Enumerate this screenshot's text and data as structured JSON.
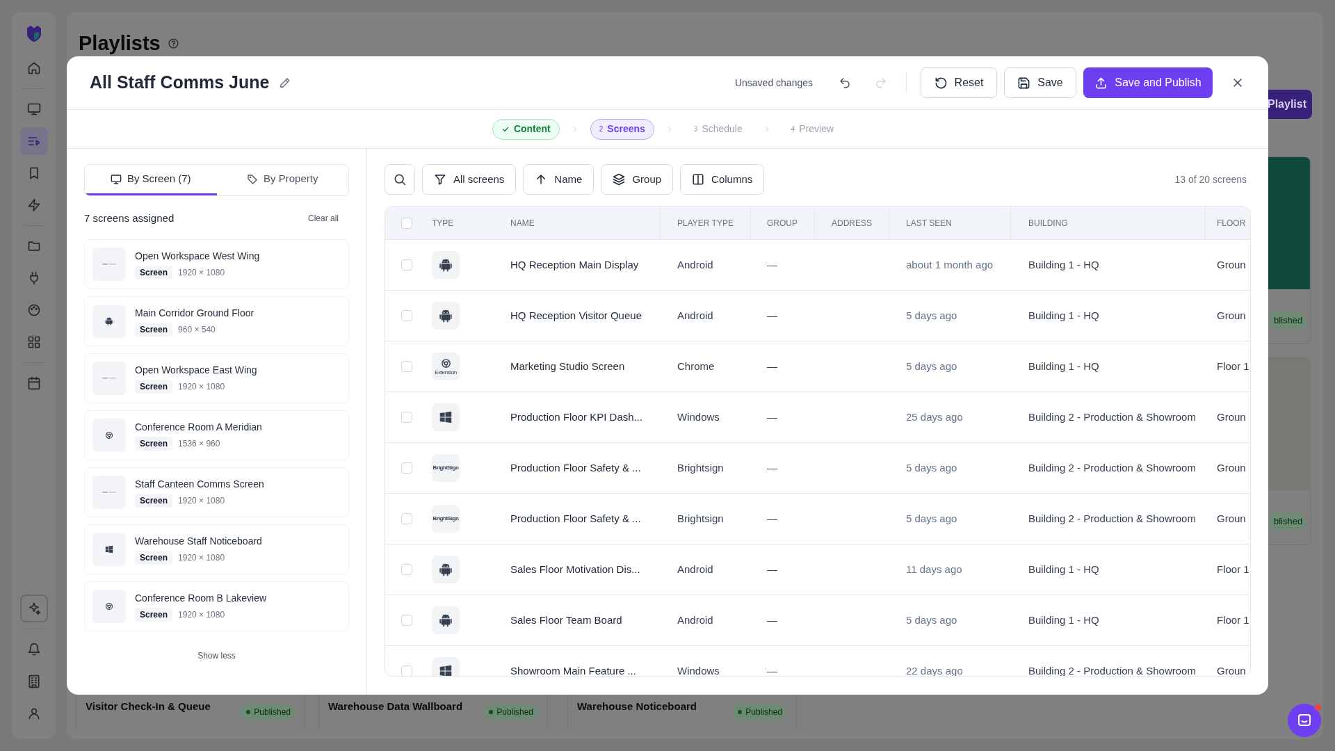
{
  "nav": {
    "sections_top": [
      [
        {
          "selected": false
        }
      ],
      [
        {
          "selected": false
        },
        {
          "selected": true
        },
        {
          "selected": false
        },
        {
          "selected": false
        }
      ],
      [
        {
          "selected": false
        },
        {
          "selected": false
        },
        {
          "selected": false
        },
        {
          "selected": false
        }
      ],
      [
        {
          "selected": false
        }
      ]
    ],
    "sections_bottom": [
      [
        {
          "selected": false
        }
      ],
      [
        {
          "selected": false
        },
        {
          "selected": false
        },
        {
          "selected": false
        }
      ]
    ]
  },
  "page": {
    "title": "Playlists",
    "new_button": "Playlist",
    "side_cards": [
      {
        "status": "blished"
      },
      {
        "status": "blished"
      }
    ],
    "bottom_cards": [
      {
        "title": "Visitor Check-In & Queue",
        "status": "Published"
      },
      {
        "title": "Warehouse Data Wallboard",
        "status": "Published"
      },
      {
        "title": "Warehouse Noticeboard",
        "status": "Published"
      }
    ]
  },
  "modal": {
    "title": "All Staff Comms June",
    "unsaved": "Unsaved changes",
    "undo": {
      "disabled": false
    },
    "redo": {
      "disabled": true
    },
    "buttons": [
      {
        "kind": "reset",
        "label": "Reset"
      },
      {
        "kind": "save",
        "label": "Save"
      },
      {
        "kind": "publish",
        "label": "Save and Publish"
      }
    ],
    "steps": [
      {
        "label": "Content",
        "completed": true,
        "selected": false
      },
      {
        "number": "2",
        "label": "Screens",
        "completed": false,
        "selected": true
      },
      {
        "number": "3",
        "label": "Schedule",
        "completed": false,
        "selected": false
      },
      {
        "number": "4",
        "label": "Preview",
        "completed": false,
        "selected": false
      }
    ],
    "left": {
      "tabs": [
        {
          "label": "By Screen (7)",
          "selected": true
        },
        {
          "label": "By Property",
          "selected": false
        }
      ],
      "assigned": "7 screens assigned",
      "clear": "Clear all",
      "screens": [
        {
          "name": "Open Workspace West Wing",
          "badge": "Screen",
          "resolution": "1920 × 1080",
          "kind": "brightsign"
        },
        {
          "name": "Main Corridor Ground Floor",
          "badge": "Screen",
          "resolution": "960 × 540",
          "kind": "android"
        },
        {
          "name": "Open Workspace East Wing",
          "badge": "Screen",
          "resolution": "1920 × 1080",
          "kind": "brightsign"
        },
        {
          "name": "Conference Room A Meridian",
          "badge": "Screen",
          "resolution": "1536 × 960",
          "kind": "chrome"
        },
        {
          "name": "Staff Canteen Comms Screen",
          "badge": "Screen",
          "resolution": "1920 × 1080",
          "kind": "brightsign"
        },
        {
          "name": "Warehouse Staff Noticeboard",
          "badge": "Screen",
          "resolution": "1920 × 1080",
          "kind": "windows"
        },
        {
          "name": "Conference Room B Lakeview",
          "badge": "Screen",
          "resolution": "1920 × 1080",
          "kind": "chrome"
        }
      ],
      "show_less": "Show less"
    },
    "filters": [
      {
        "label": "All screens"
      },
      {
        "label": "Name"
      },
      {
        "label": "Group"
      },
      {
        "label": "Columns"
      }
    ],
    "count": "13 of 20 screens",
    "table": {
      "select_all": {
        "checked": false
      },
      "columns": [
        "TYPE",
        "NAME",
        "PLAYER TYPE",
        "GROUP",
        "ADDRESS",
        "LAST SEEN",
        "BUILDING",
        "FLOOR"
      ],
      "rows": [
        {
          "checked": false,
          "kind": "android",
          "name": "HQ Reception Main Display",
          "player_type": "Android",
          "group": "—",
          "last_seen": "about 1 month ago",
          "building": "Building 1 - HQ",
          "floor": "Groun"
        },
        {
          "checked": false,
          "kind": "android",
          "name": "HQ Reception Visitor Queue",
          "player_type": "Android",
          "group": "—",
          "last_seen": "5 days ago",
          "building": "Building 1 - HQ",
          "floor": "Groun"
        },
        {
          "checked": false,
          "kind": "chrome",
          "logo_text": "Extension",
          "name": "Marketing Studio Screen",
          "player_type": "Chrome",
          "group": "—",
          "last_seen": "5 days ago",
          "building": "Building 1 - HQ",
          "floor": "Floor 1"
        },
        {
          "checked": false,
          "kind": "windows",
          "name": "Production Floor KPI Dash...",
          "player_type": "Windows",
          "group": "—",
          "last_seen": "25 days ago",
          "building": "Building 2 - Production & Showroom",
          "floor": "Groun"
        },
        {
          "checked": false,
          "kind": "brightsign",
          "logo_text": "BrightSign",
          "name": "Production Floor Safety & ...",
          "player_type": "Brightsign",
          "group": "—",
          "last_seen": "5 days ago",
          "building": "Building 2 - Production & Showroom",
          "floor": "Groun"
        },
        {
          "checked": false,
          "kind": "brightsign",
          "logo_text": "BrightSign",
          "name": "Production Floor Safety & ...",
          "player_type": "Brightsign",
          "group": "—",
          "last_seen": "5 days ago",
          "building": "Building 2 - Production & Showroom",
          "floor": "Groun"
        },
        {
          "checked": false,
          "kind": "android",
          "name": "Sales Floor Motivation Dis...",
          "player_type": "Android",
          "group": "—",
          "last_seen": "11 days ago",
          "building": "Building 1 - HQ",
          "floor": "Floor 1"
        },
        {
          "checked": false,
          "kind": "android",
          "name": "Sales Floor Team Board",
          "player_type": "Android",
          "group": "—",
          "last_seen": "5 days ago",
          "building": "Building 1 - HQ",
          "floor": "Floor 1"
        },
        {
          "checked": false,
          "kind": "windows",
          "name": "Showroom Main Feature ...",
          "player_type": "Windows",
          "group": "—",
          "last_seen": "22 days ago",
          "building": "Building 2 - Production & Showroom",
          "floor": "Groun"
        }
      ]
    }
  },
  "chat": {
    "unread": true
  }
}
